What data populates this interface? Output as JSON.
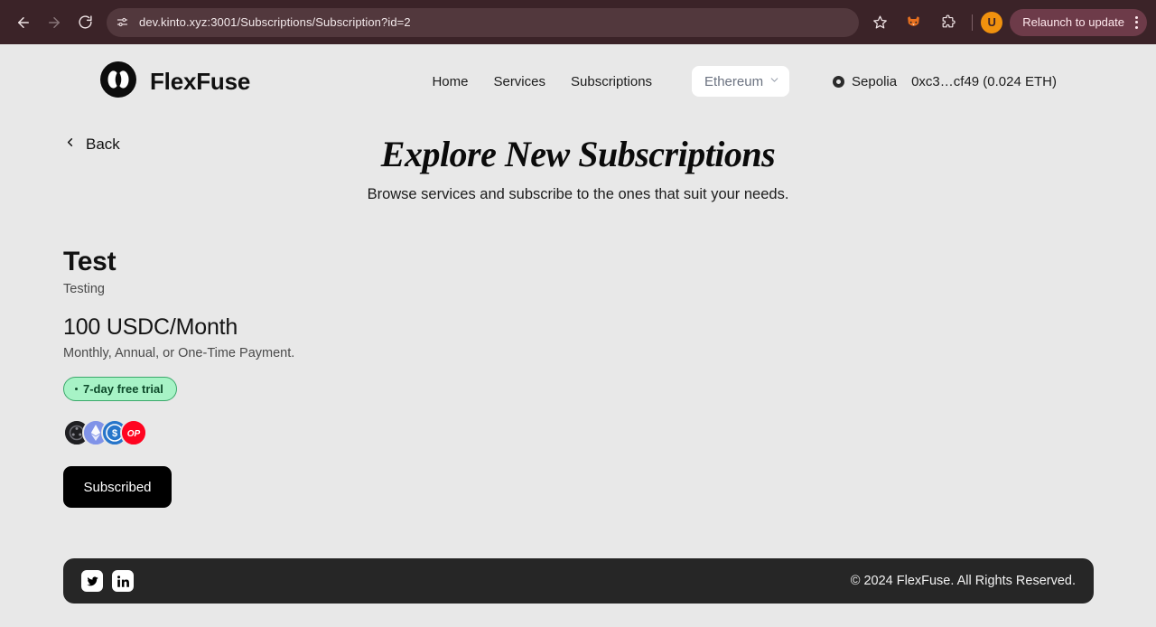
{
  "browser": {
    "back_icon": "arrow-left-icon",
    "forward_icon": "arrow-right-icon",
    "reload_icon": "reload-icon",
    "site_settings_icon": "tune-sliders-icon",
    "url": "dev.kinto.xyz:3001/Subscriptions/Subscription?id=2",
    "bookmark_icon": "star-icon",
    "extension_fox_icon": "fox-extension-icon",
    "extensions_icon": "puzzle-piece-icon",
    "profile_initial": "U",
    "relaunch_label": "Relaunch to update",
    "menu_icon": "kebab-menu-icon",
    "chrome_bg": "#3b2328",
    "omnibox_bg": "#52383d"
  },
  "header": {
    "logo_icon": "flexfuse-logo-icon",
    "brand": "FlexFuse",
    "nav": [
      {
        "label": "Home",
        "name": "nav-link-home"
      },
      {
        "label": "Services",
        "name": "nav-link-services"
      },
      {
        "label": "Subscriptions",
        "name": "nav-link-subscriptions"
      }
    ],
    "chain_select": {
      "value": "Ethereum",
      "chevron_icon": "chevron-down-icon"
    },
    "wallet": {
      "status_icon": "network-status-icon",
      "network": "Sepolia",
      "address_balance": "0xc3…cf49 (0.024 ETH)"
    }
  },
  "hero": {
    "back_label": "Back",
    "back_icon": "chevron-left-icon",
    "title": "Explore New Subscriptions",
    "subtitle": "Browse services and subscribe to the ones that suit your needs."
  },
  "offering": {
    "title": "Test",
    "description": "Testing",
    "price": "100 USDC/Month",
    "terms": "Monthly, Annual, or One-Time Payment.",
    "trial_badge": "7-day free trial",
    "tokens": [
      {
        "name": "base-token-icon",
        "label": "Base",
        "color": "#1f1f22"
      },
      {
        "name": "ethereum-token-icon",
        "label": "ETH",
        "color": "#8093e8"
      },
      {
        "name": "usdc-token-icon",
        "label": "USDC",
        "color": "#2775ca"
      },
      {
        "name": "optimism-token-icon",
        "label": "OP",
        "color": "#ff0420"
      }
    ],
    "op_label": "OP",
    "action_label": "Subscribed"
  },
  "footer": {
    "twitter_icon": "twitter-icon",
    "linkedin_icon": "linkedin-icon",
    "copyright": "© 2024 FlexFuse. All Rights Reserved."
  },
  "colors": {
    "page_bg": "#e8e8e8",
    "footer_bg": "#262626",
    "accent_green": "#a7f3c6",
    "button_black": "#000000"
  }
}
